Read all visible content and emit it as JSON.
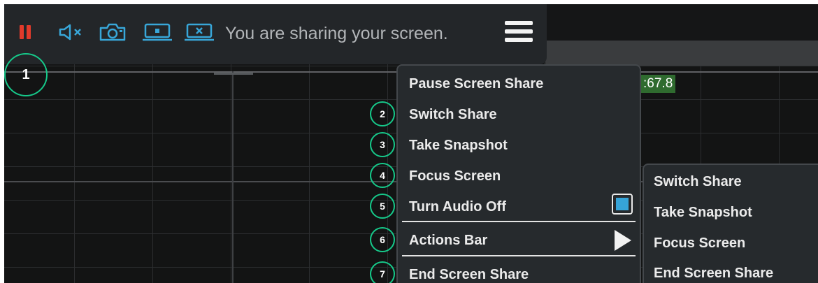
{
  "toolbar": {
    "status_text": "You are sharing your screen.",
    "icons": [
      "pause-icon",
      "speaker-muted-icon",
      "camera-icon",
      "screen-focus-icon",
      "screen-close-icon",
      "hamburger-menu-icon"
    ]
  },
  "steps": {
    "s1": "1",
    "s2": "2",
    "s3": "3",
    "s4": "4",
    "s5": "5",
    "s6": "6",
    "s7": "7"
  },
  "readout": ":67.8",
  "menu": {
    "pause": "Pause Screen Share",
    "switch": "Switch Share",
    "snapshot": "Take Snapshot",
    "focus": "Focus Screen",
    "audio": "Turn Audio Off",
    "actions": "Actions Bar",
    "end": "End Screen Share"
  },
  "submenu": {
    "switch": "Switch Share",
    "snapshot": "Take Snapshot",
    "focus": "Focus Screen",
    "end": "End Screen Share"
  },
  "colors": {
    "accent_blue": "#36a4d8",
    "pause_red": "#e23a2b",
    "step_green": "#16c98a",
    "readout_green": "#2f6b2f"
  }
}
